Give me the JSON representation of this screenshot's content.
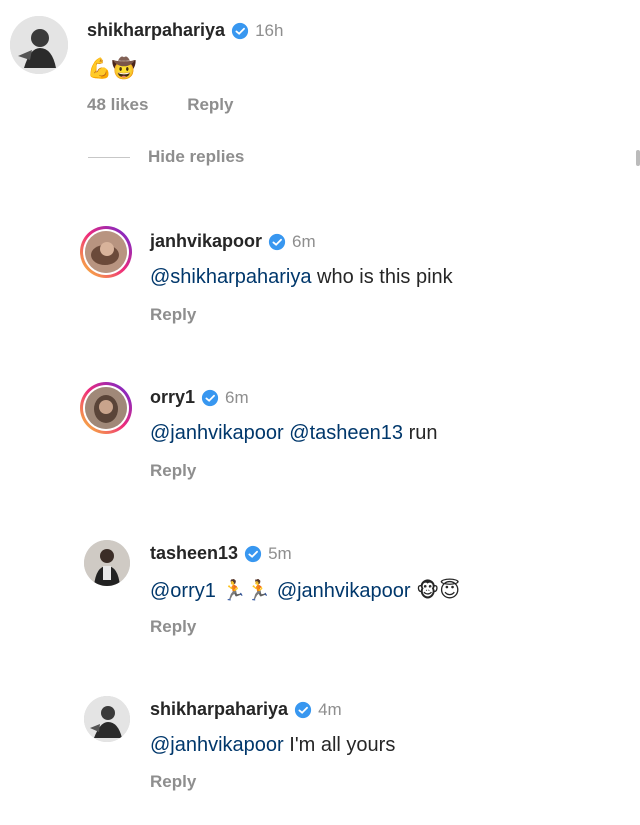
{
  "comments": [
    {
      "username": "shikharpahariya",
      "time": "16h",
      "emoji": "💪🤠",
      "likes": "48 likes",
      "reply": "Reply"
    },
    {
      "username": "janhvikapoor",
      "time": "6m",
      "mention": "@shikharpahariya",
      "text": " who is this pink",
      "reply": "Reply"
    },
    {
      "username": "orry1",
      "time": "6m",
      "mention1": "@janhvikapoor",
      "mention2": "@tasheen13",
      "text": " run",
      "reply": "Reply"
    },
    {
      "username": "tasheen13",
      "time": "5m",
      "mention1": "@orry1",
      "emoji1": "🏃🏃",
      "mention2": "@janhvikapoor",
      "emoji2": "🐵😇",
      "reply": "Reply"
    },
    {
      "username": "shikharpahariya",
      "time": "4m",
      "mention": "@janhvikapoor",
      "text": " I'm all yours",
      "reply": "Reply"
    }
  ],
  "hide_replies": "Hide replies",
  "colors": {
    "mention": "#00376b",
    "verified": "#3897f0",
    "secondary": "#8e8e8e"
  }
}
